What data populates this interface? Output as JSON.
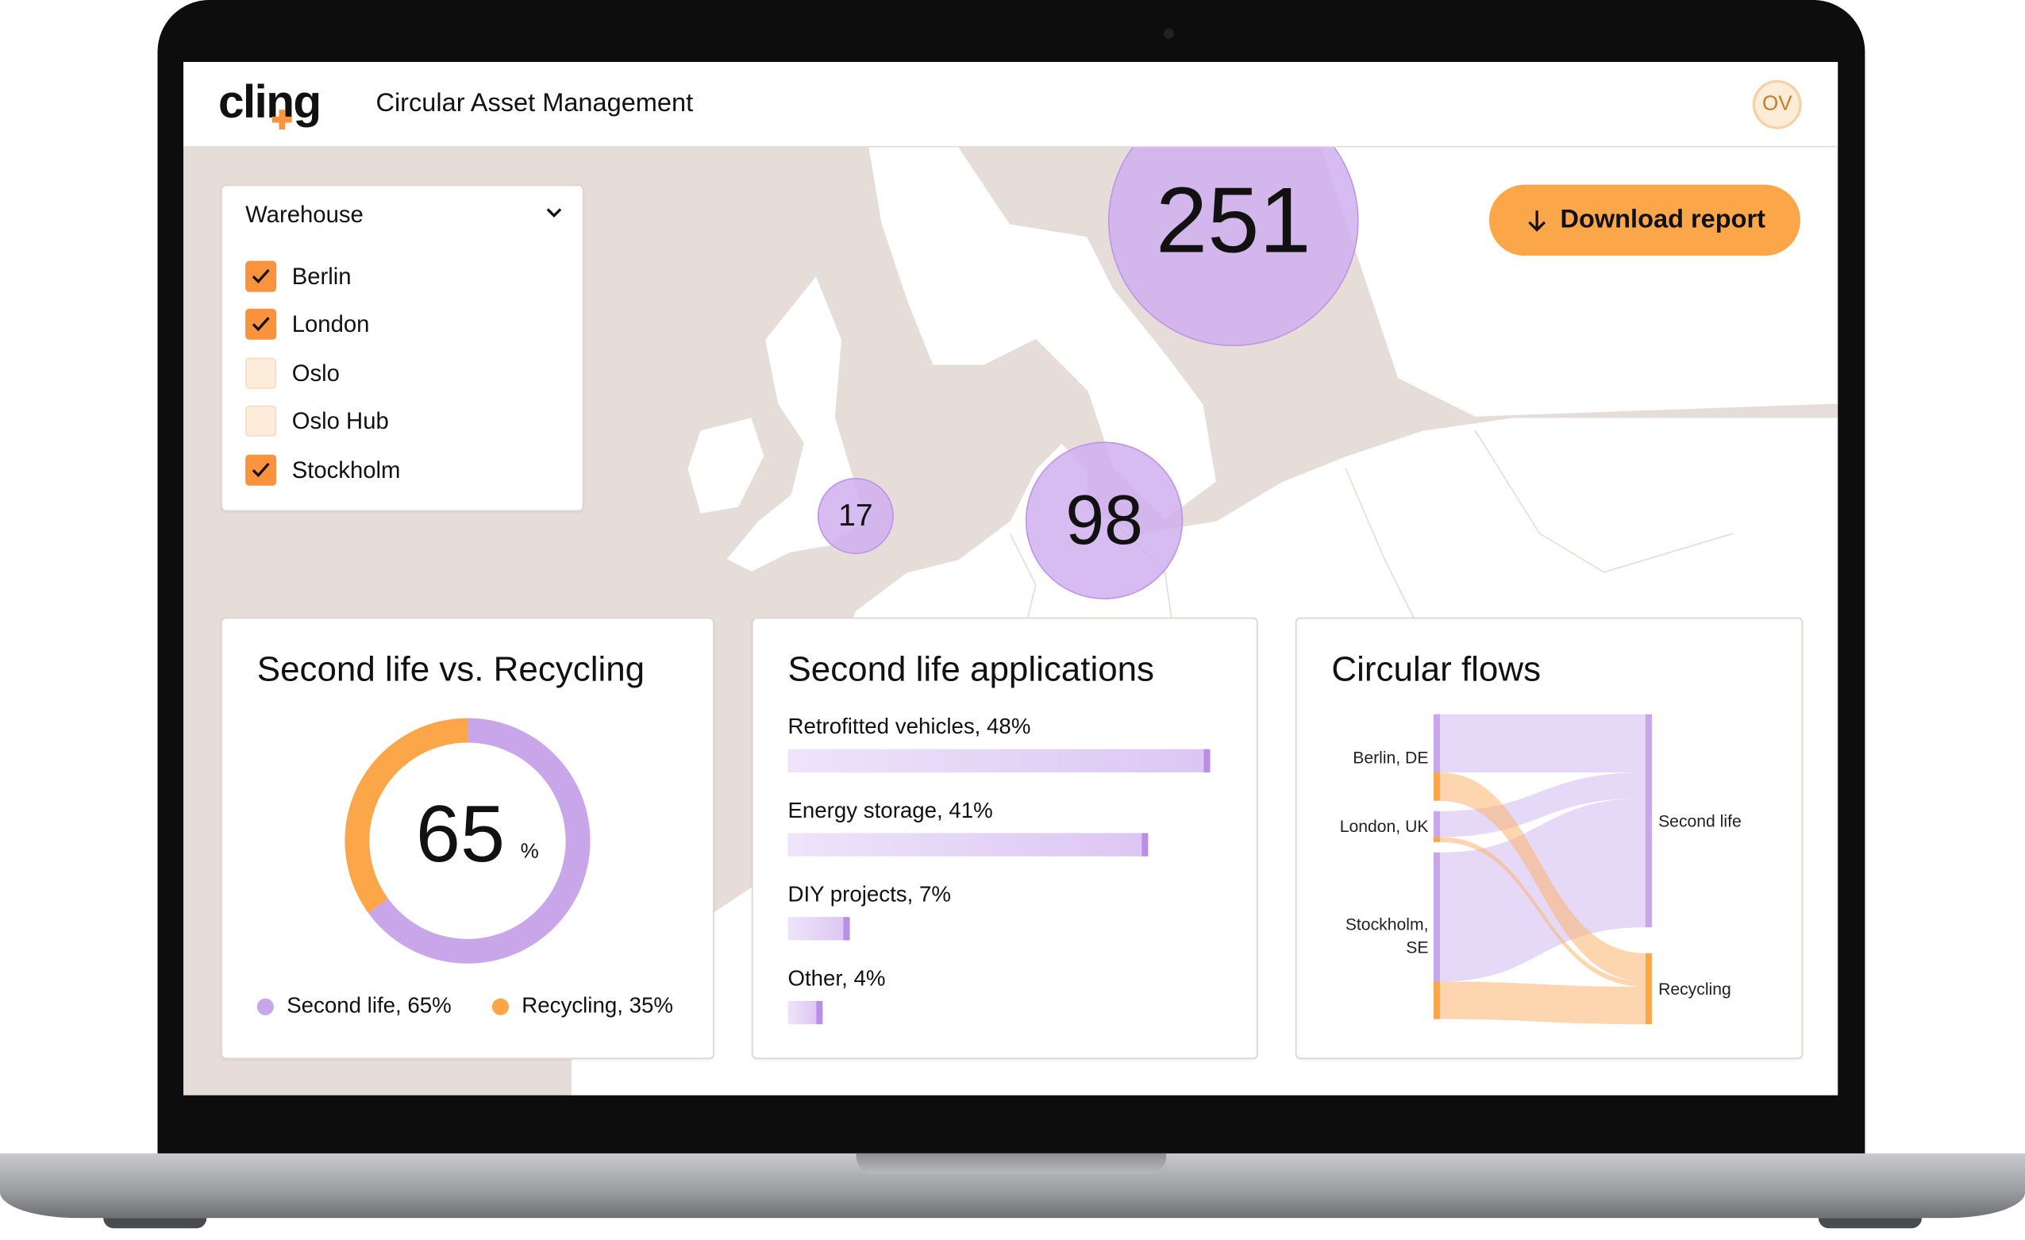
{
  "header": {
    "logo": "cling",
    "title": "Circular Asset Management",
    "avatar": "OV"
  },
  "filter": {
    "label": "Warehouse",
    "icon": "chevron-down-icon",
    "options": [
      {
        "label": "Berlin",
        "checked": true
      },
      {
        "label": "London",
        "checked": true
      },
      {
        "label": "Oslo",
        "checked": false
      },
      {
        "label": "Oslo Hub",
        "checked": false
      },
      {
        "label": "Stockholm",
        "checked": true
      }
    ]
  },
  "map": {
    "bubbles": [
      {
        "value": "251"
      },
      {
        "value": "17"
      },
      {
        "value": "98"
      }
    ]
  },
  "download": {
    "label": "Download report",
    "icon": "arrow-down-icon"
  },
  "colors": {
    "accent": "#fb923c",
    "purple": "#c9a5ea",
    "sea": "#e6ddd9"
  },
  "chart_data": [
    {
      "type": "pie",
      "title": "Second life vs. Recycling",
      "center_value": "65",
      "center_unit": "%",
      "categories": [
        "Second life",
        "Recycling"
      ],
      "values": [
        65,
        35
      ],
      "legend": [
        "Second life, 65%",
        "Recycling, 35%"
      ],
      "colors": [
        "#c9a5ea",
        "#fca64a"
      ]
    },
    {
      "type": "bar",
      "title": "Second life applications",
      "orientation": "horizontal",
      "categories": [
        "Retrofitted vehicles",
        "Energy storage",
        "DIY projects",
        "Other"
      ],
      "values": [
        48,
        41,
        7,
        4
      ],
      "labels": [
        "Retrofitted vehicles, 48%",
        "Energy storage, 41%",
        "DIY projects, 7%",
        "Other, 4%"
      ]
    },
    {
      "type": "sankey",
      "title": "Circular flows",
      "sources": [
        "Berlin, DE",
        "London, UK",
        "Stockholm, SE"
      ],
      "targets": [
        "Second life",
        "Recycling"
      ],
      "flows": [
        {
          "from": "Berlin, DE",
          "to": "Second life",
          "value": 45
        },
        {
          "from": "Berlin, DE",
          "to": "Recycling",
          "value": 22
        },
        {
          "from": "London, UK",
          "to": "Second life",
          "value": 20
        },
        {
          "from": "London, UK",
          "to": "Recycling",
          "value": 4
        },
        {
          "from": "Stockholm, SE",
          "to": "Second life",
          "value": 100
        },
        {
          "from": "Stockholm, SE",
          "to": "Recycling",
          "value": 29
        }
      ]
    }
  ]
}
